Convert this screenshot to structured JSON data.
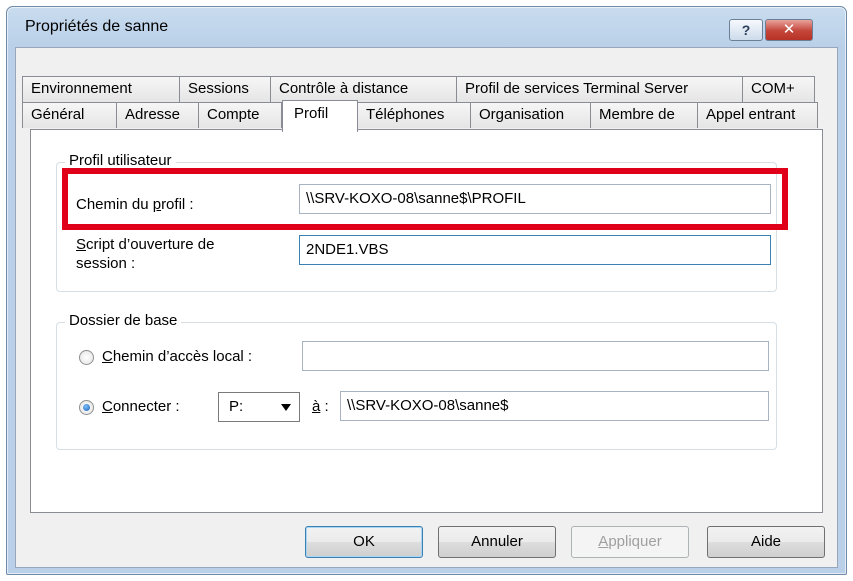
{
  "window": {
    "title": "Propriétés de sanne",
    "help_label": "?",
    "close_label": "✕"
  },
  "tabs": {
    "row1": [
      "Environnement",
      "Sessions",
      "Contrôle à distance",
      "Profil de services Terminal Server",
      "COM+"
    ],
    "row2": [
      "Général",
      "Adresse",
      "Compte",
      "Profil",
      "Téléphones",
      "Organisation",
      "Membre de",
      "Appel entrant"
    ],
    "active": "Profil"
  },
  "profile_group": {
    "legend": "Profil utilisateur",
    "profile_path_label_pre": "Chemin du ",
    "profile_path_label_accel": "p",
    "profile_path_label_post": "rofil :",
    "profile_path_value": "\\\\SRV-KOXO-08\\sanne$\\PROFIL",
    "logon_script_label_accel": "S",
    "logon_script_label_line1": "cript d’ouverture de",
    "logon_script_label_line2": "session :",
    "logon_script_value": "2NDE1.VBS"
  },
  "home_group": {
    "legend": "Dossier de base",
    "local_path_accel": "C",
    "local_path_label": "hemin d’accès local :",
    "local_path_value": "",
    "connect_accel": "C",
    "connect_label": "onnecter :",
    "drive_value": "P:",
    "to_accel": "à",
    "to_suffix": " :",
    "connect_value": "\\\\SRV-KOXO-08\\sanne$"
  },
  "buttons": {
    "ok": "OK",
    "cancel": "Annuler",
    "apply_accel": "A",
    "apply_rest": "ppliquer",
    "help": "Aide"
  }
}
